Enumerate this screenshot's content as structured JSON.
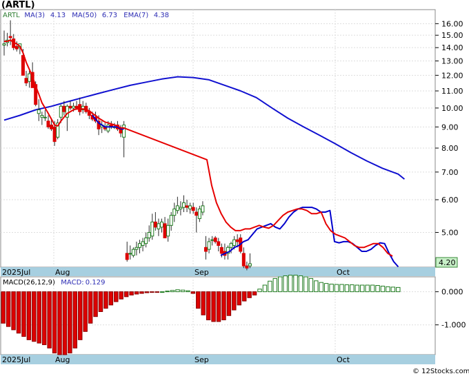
{
  "chart_data": [
    {
      "type": "candlestick",
      "title": "(ARTL)",
      "legend": [
        {
          "text": "ARTL",
          "color": "#2e7d32"
        },
        {
          "text": "MA(3)",
          "color": "#2d2db4"
        },
        {
          "text": "4.13",
          "color": "#2d2db4"
        },
        {
          "text": "MA(50)",
          "color": "#2d2db4"
        },
        {
          "text": "6.73",
          "color": "#2d2db4"
        },
        {
          "text": "EMA(7)",
          "color": "#2d2db4"
        },
        {
          "text": "4.38",
          "color": "#2d2db4"
        }
      ],
      "y_scale": "log",
      "ylim": [
        4.12,
        17.3
      ],
      "y_ticks": [
        "16.00",
        "15.00",
        "14.00",
        "13.00",
        "12.00",
        "11.00",
        "10.00",
        "9.00",
        "8.00",
        "7.00",
        "6.00",
        "5.00"
      ],
      "x_labels": [
        "2025Jul",
        "Aug",
        "Sep",
        "Oct"
      ],
      "last_price_label": "4.20",
      "colors": {
        "up": "#1f7a1f",
        "down": "#dd0000",
        "ma3": "#0000cc",
        "ma50": "#1010d0",
        "ema7": "#e60000",
        "tag": "#c8f0c8"
      },
      "candles": [
        [
          14.2,
          15.4,
          13.4,
          14.3
        ],
        [
          14.4,
          15.2,
          14.1,
          14.6
        ],
        [
          14.9,
          16.3,
          14.2,
          14.8
        ],
        [
          14.7,
          15.1,
          13.8,
          14.0
        ],
        [
          14.1,
          14.5,
          13.7,
          13.9
        ],
        [
          14.0,
          14.3,
          13.5,
          14.3
        ],
        [
          13.4,
          13.9,
          12.1,
          12.0
        ],
        [
          11.8,
          12.3,
          11.3,
          11.5
        ],
        [
          11.6,
          12.3,
          11.2,
          12.1
        ],
        [
          12.2,
          12.9,
          11.5,
          11.2
        ],
        [
          11.4,
          11.6,
          10.1,
          10.2
        ],
        [
          9.7,
          10.5,
          9.3,
          9.9
        ],
        [
          9.5,
          9.8,
          9.1,
          9.6
        ],
        [
          9.5,
          9.9,
          9.3,
          9.5
        ],
        [
          9.3,
          9.6,
          8.9,
          9.0
        ],
        [
          9.1,
          9.4,
          8.8,
          8.9
        ],
        [
          9.0,
          9.3,
          8.1,
          8.3
        ],
        [
          8.5,
          9.4,
          8.4,
          9.2
        ],
        [
          9.5,
          10.2,
          9.2,
          10.1
        ],
        [
          10.1,
          10.4,
          9.6,
          9.8
        ],
        [
          9.5,
          10.2,
          8.8,
          10.1
        ],
        [
          10.1,
          10.4,
          9.9,
          10.0
        ],
        [
          10.0,
          10.3,
          9.8,
          10.1
        ],
        [
          10.1,
          10.4,
          9.9,
          10.0
        ],
        [
          10.2,
          10.6,
          9.6,
          9.8
        ],
        [
          9.9,
          10.4,
          9.7,
          10.1
        ],
        [
          10.1,
          10.3,
          9.7,
          9.8
        ],
        [
          9.8,
          10.0,
          9.4,
          9.6
        ],
        [
          9.6,
          9.8,
          9.3,
          9.4
        ],
        [
          9.5,
          9.8,
          9.2,
          9.3
        ],
        [
          9.3,
          9.6,
          8.6,
          8.9
        ],
        [
          9.0,
          9.3,
          8.7,
          9.1
        ],
        [
          9.0,
          9.2,
          8.8,
          8.9
        ],
        [
          8.8,
          9.3,
          8.7,
          9.1
        ],
        [
          9.1,
          9.3,
          8.9,
          9.0
        ],
        [
          9.0,
          9.2,
          8.9,
          9.0
        ],
        [
          9.1,
          9.3,
          8.8,
          8.9
        ],
        [
          8.9,
          9.1,
          8.5,
          8.7
        ],
        [
          8.5,
          9.3,
          7.6,
          9.1
        ],
        [
          4.45,
          4.75,
          4.25,
          4.3
        ],
        [
          4.45,
          4.65,
          4.3,
          4.45
        ],
        [
          4.4,
          4.6,
          4.35,
          4.55
        ],
        [
          4.55,
          4.75,
          4.4,
          4.6
        ],
        [
          4.6,
          4.8,
          4.45,
          4.7
        ],
        [
          4.65,
          4.85,
          4.5,
          4.75
        ],
        [
          4.7,
          5.0,
          4.6,
          4.85
        ],
        [
          4.85,
          5.2,
          4.75,
          5.0
        ],
        [
          4.9,
          5.55,
          4.8,
          5.3
        ],
        [
          5.3,
          5.6,
          5.05,
          5.15
        ],
        [
          5.1,
          5.4,
          4.9,
          5.25
        ],
        [
          5.15,
          5.4,
          5.0,
          5.3
        ],
        [
          5.25,
          5.45,
          5.0,
          4.85
        ],
        [
          4.9,
          5.4,
          4.75,
          5.2
        ],
        [
          5.2,
          5.6,
          5.05,
          5.5
        ],
        [
          5.5,
          5.9,
          5.3,
          5.7
        ],
        [
          5.65,
          6.1,
          5.55,
          5.8
        ],
        [
          5.7,
          5.95,
          5.5,
          5.75
        ],
        [
          5.75,
          6.15,
          5.6,
          5.9
        ],
        [
          5.8,
          6.0,
          5.6,
          5.75
        ],
        [
          5.7,
          5.9,
          5.55,
          5.8
        ],
        [
          5.75,
          5.9,
          5.55,
          5.65
        ],
        [
          5.6,
          5.75,
          5.0,
          5.5
        ],
        [
          5.4,
          5.8,
          5.3,
          5.7
        ],
        [
          5.6,
          5.95,
          5.5,
          5.8
        ],
        [
          4.6,
          4.9,
          4.3,
          4.5
        ],
        [
          4.55,
          4.85,
          4.45,
          4.75
        ],
        [
          4.8,
          4.9,
          4.65,
          4.8
        ],
        [
          4.85,
          4.9,
          4.7,
          4.75
        ],
        [
          4.75,
          4.85,
          4.5,
          4.65
        ],
        [
          4.6,
          4.7,
          4.35,
          4.45
        ],
        [
          4.5,
          4.7,
          4.3,
          4.4
        ],
        [
          4.45,
          4.65,
          4.3,
          4.6
        ],
        [
          4.6,
          4.75,
          4.45,
          4.7
        ],
        [
          4.65,
          4.9,
          4.55,
          4.8
        ],
        [
          4.8,
          4.95,
          4.6,
          4.75
        ],
        [
          4.85,
          4.95,
          4.45,
          4.5
        ],
        [
          4.45,
          4.6,
          4.1,
          4.15
        ],
        [
          4.15,
          4.25,
          4.05,
          4.1
        ],
        [
          4.15,
          4.45,
          4.1,
          4.2
        ]
      ],
      "ma3": [
        14.3,
        14.4,
        14.5,
        14.4,
        14.1,
        14.0,
        13.4,
        12.6,
        11.9,
        11.6,
        11.2,
        10.4,
        9.9,
        9.7,
        9.4,
        9.1,
        8.8,
        8.8,
        9.2,
        9.7,
        10.0,
        10.0,
        10.1,
        10.0,
        10.0,
        10.0,
        9.9,
        9.8,
        9.6,
        9.4,
        9.2,
        9.1,
        9.0,
        9.0,
        9.0,
        9.0,
        9.0,
        8.9,
        8.9,
        4.4,
        4.45,
        4.5,
        4.6,
        4.65,
        4.75,
        4.8,
        4.95,
        5.1,
        5.15,
        5.2,
        5.25,
        5.15,
        5.1,
        5.25,
        5.45,
        5.6,
        5.7,
        5.75,
        5.75,
        5.75,
        5.7,
        5.6,
        5.6,
        5.65,
        4.75,
        4.72,
        4.75,
        4.75,
        4.7,
        4.6,
        4.5,
        4.5,
        4.55,
        4.65,
        4.72,
        4.7,
        4.45,
        4.25,
        4.13
      ],
      "ema7": [
        14.5,
        14.5,
        14.6,
        14.4,
        14.3,
        14.1,
        13.6,
        12.9,
        12.4,
        11.9,
        11.3,
        10.8,
        10.3,
        10.0,
        9.7,
        9.4,
        9.1,
        9.05,
        9.3,
        9.5,
        9.7,
        9.8,
        9.9,
        9.95,
        9.95,
        9.95,
        9.9,
        9.85,
        9.7,
        9.6,
        9.45,
        9.35,
        9.25,
        9.2,
        9.15,
        9.1,
        9.05,
        8.95,
        8.95,
        7.5,
        6.5,
        5.9,
        5.55,
        5.3,
        5.15,
        5.05,
        5.05,
        5.1,
        5.1,
        5.15,
        5.2,
        5.15,
        5.12,
        5.2,
        5.35,
        5.5,
        5.6,
        5.65,
        5.7,
        5.7,
        5.65,
        5.55,
        5.55,
        5.6,
        5.25,
        5.05,
        4.95,
        4.9,
        4.85,
        4.75,
        4.65,
        4.6,
        4.6,
        4.65,
        4.7,
        4.7,
        4.6,
        4.45,
        4.38
      ],
      "ma50": [
        [
          0,
          9.35
        ],
        [
          5,
          9.6
        ],
        [
          10,
          9.9
        ],
        [
          15,
          10.1
        ],
        [
          20,
          10.35
        ],
        [
          25,
          10.6
        ],
        [
          30,
          10.85
        ],
        [
          35,
          11.1
        ],
        [
          40,
          11.35
        ],
        [
          45,
          11.55
        ],
        [
          50,
          11.75
        ],
        [
          55,
          11.9
        ],
        [
          60,
          11.85
        ],
        [
          65,
          11.7
        ],
        [
          70,
          11.35
        ],
        [
          75,
          11.0
        ],
        [
          80,
          10.6
        ],
        [
          85,
          10.0
        ],
        [
          90,
          9.45
        ],
        [
          95,
          9.0
        ],
        [
          100,
          8.6
        ],
        [
          105,
          8.2
        ],
        [
          110,
          7.8
        ],
        [
          115,
          7.45
        ],
        [
          120,
          7.15
        ],
        [
          125,
          6.92
        ],
        [
          127,
          6.73
        ]
      ]
    },
    {
      "type": "bar",
      "title": "MACD(26,12,9)",
      "legend": [
        {
          "text": "MACD(26,12,9)",
          "color": "#000000"
        },
        {
          "text": "MACD:",
          "color": "#2d2db4"
        },
        {
          "text": "0.129",
          "color": "#2d2db4"
        }
      ],
      "ylim": [
        -1.9,
        0.45
      ],
      "y_ticks": [
        "0.000",
        "-1.000"
      ],
      "x_labels": [
        "2025Jul",
        "Aug",
        "Sep",
        "Oct"
      ],
      "colors": {
        "positive": "#1e7a1e",
        "negative": "#dd0000"
      },
      "values": [
        -0.95,
        -1.05,
        -1.15,
        -1.25,
        -1.35,
        -1.45,
        -1.5,
        -1.55,
        -1.6,
        -1.7,
        -1.85,
        -1.9,
        -1.9,
        -1.85,
        -1.7,
        -1.45,
        -1.2,
        -0.95,
        -0.75,
        -0.6,
        -0.5,
        -0.4,
        -0.3,
        -0.22,
        -0.15,
        -0.1,
        -0.07,
        -0.05,
        -0.03,
        -0.02,
        -0.01,
        0.0,
        0.02,
        0.04,
        0.06,
        0.05,
        0.03,
        -0.05,
        -0.5,
        -0.7,
        -0.85,
        -0.9,
        -0.9,
        -0.85,
        -0.72,
        -0.55,
        -0.4,
        -0.28,
        -0.18,
        -0.1,
        0.08,
        0.2,
        0.32,
        0.4,
        0.45,
        0.48,
        0.5,
        0.5,
        0.48,
        0.45,
        0.4,
        0.33,
        0.28,
        0.25,
        0.23,
        0.22,
        0.22,
        0.21,
        0.21,
        0.2,
        0.2,
        0.2,
        0.2,
        0.19,
        0.17,
        0.15,
        0.14,
        0.13
      ]
    }
  ],
  "watermark": "© 12Stocks.com"
}
